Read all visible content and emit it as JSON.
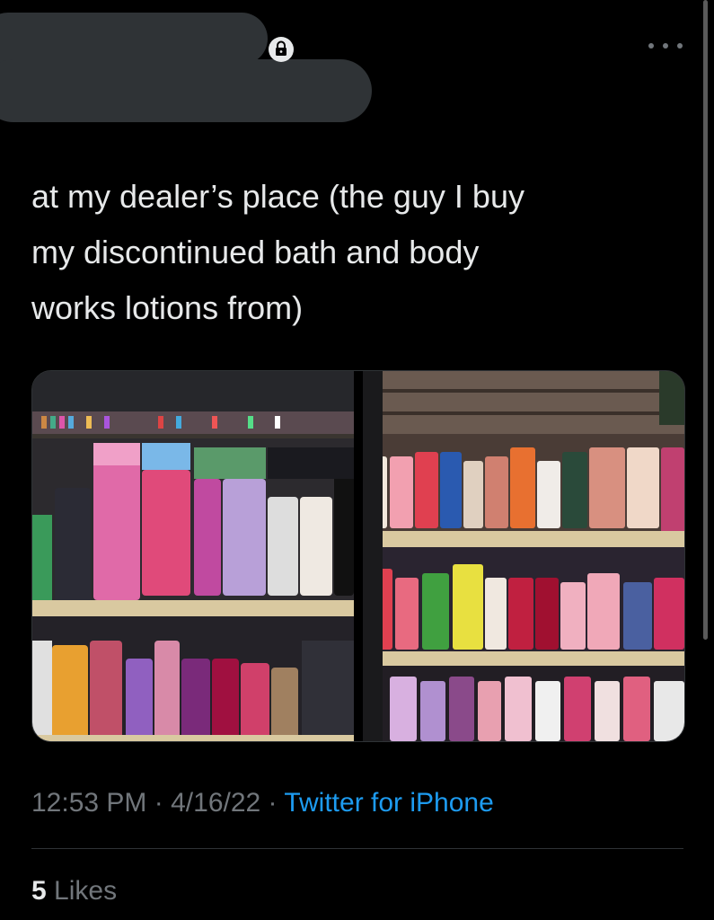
{
  "tweet": {
    "text": "at my dealer’s place (the guy I buy\nmy discontinued bath and body\nworks lotions from)",
    "time": "12:53 PM",
    "separator": "·",
    "date": "4/16/22",
    "source": "Twitter for iPhone",
    "likes_count": "5",
    "likes_label": "Likes"
  },
  "photos": [
    {
      "name": "bath and body works lotions shelf, left"
    },
    {
      "name": "bath and body works lotions shelf, right"
    }
  ],
  "icons": {
    "lock": "lock-icon",
    "more": "more-options-icon"
  },
  "colors": {
    "background": "#000000",
    "text": "#e7e9ea",
    "secondary_text": "#71767b",
    "link": "#1d9bf0",
    "divider": "#2f3336",
    "redaction": "#2f3336"
  }
}
